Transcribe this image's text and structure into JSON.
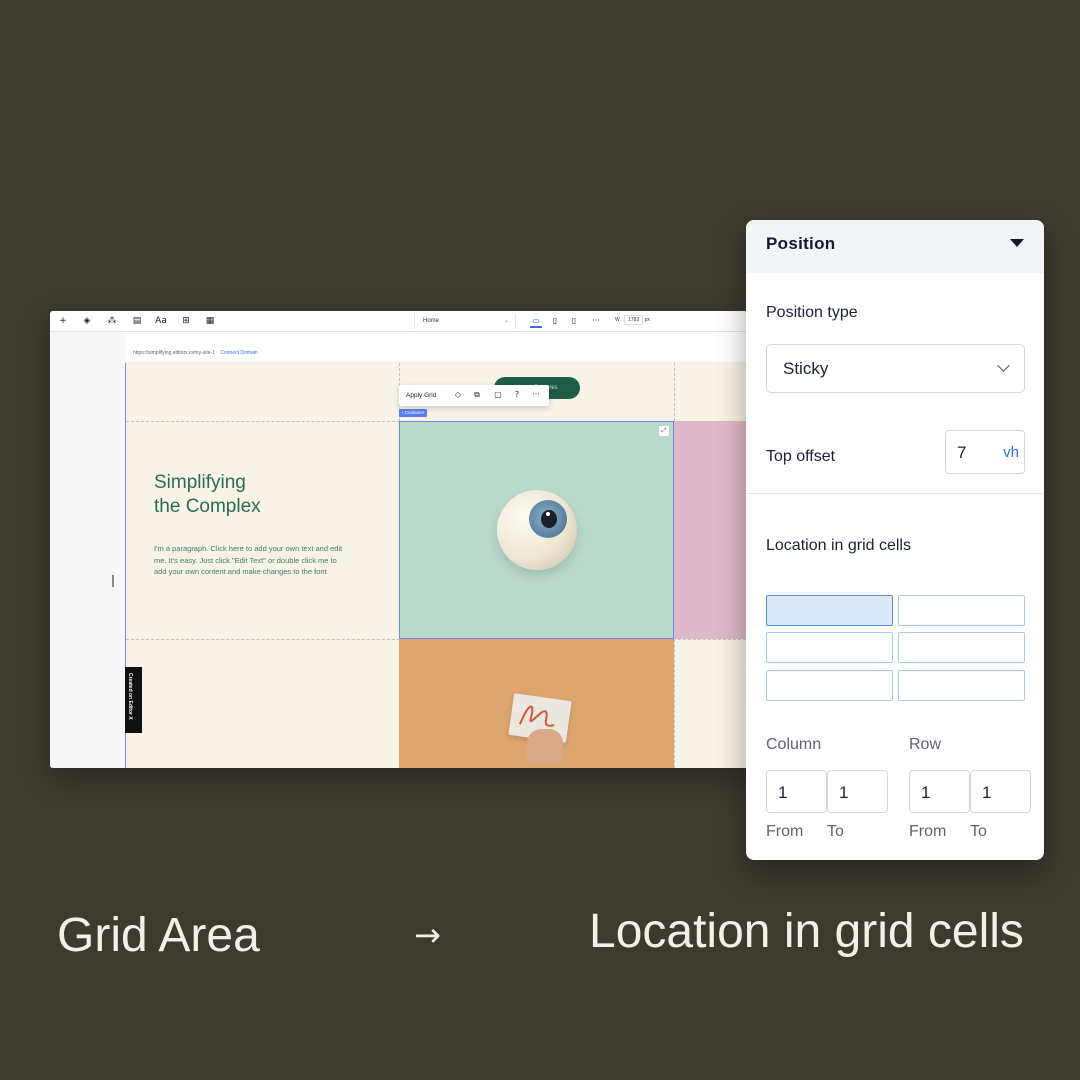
{
  "editor": {
    "toolbar": {
      "add_icon": "+",
      "layers_icon": "◈",
      "apps_icon": "⁂",
      "pages_icon": "▤",
      "text_icon": "Aa",
      "grid_icon": "⊞",
      "table_icon": "▦",
      "page_label": "Home",
      "desktop_icon": "▭",
      "tablet_icon": "▯",
      "mobile_icon": "▯",
      "more_icon": "···",
      "width_label": "W",
      "width_value": "1782",
      "width_unit": "px"
    },
    "url": {
      "text": "https://simplifying.editorx.io/my-site-1",
      "connect_label": "Connect Domain"
    },
    "canvas": {
      "headline_line1": "Simplifying",
      "headline_line2": "the Complex",
      "paragraph": "I'm a paragraph. Click here to add your own text and edit me. It's easy. Just click \"Edit Text\" or double click me to add your own content and make changes to the font",
      "pill_label": "Features",
      "side_badge": "Created on Editor X"
    },
    "context_toolbar": {
      "apply_grid": "Apply Grid",
      "container_tag": "‹ Container",
      "animate_icon": "◇",
      "duplicate_icon": "⧉",
      "comment_icon": "▢",
      "help_icon": "?",
      "more_icon": "···"
    },
    "colors": {
      "mint": "#b9d9cc",
      "pink": "#dfb9c9",
      "orange": "#dea56f",
      "cream": "#f7f3e8",
      "green_text": "#2a6b55",
      "selection_blue": "#6f86e8"
    }
  },
  "panel": {
    "title": "Position",
    "position_type_label": "Position type",
    "position_type_value": "Sticky",
    "top_offset_label": "Top offset",
    "top_offset_value": "7",
    "top_offset_unit": "vh",
    "location_label": "Location in grid cells",
    "grid": {
      "rows": 3,
      "columns": 2,
      "selected_cell": [
        1,
        1
      ]
    },
    "column_label": "Column",
    "row_label": "Row",
    "column_from": "1",
    "column_to": "1",
    "row_from": "1",
    "row_to": "1",
    "from_label": "From",
    "to_label": "To"
  },
  "captions": {
    "left": "Grid Area",
    "arrow": "→",
    "right": "Location in grid cells"
  }
}
